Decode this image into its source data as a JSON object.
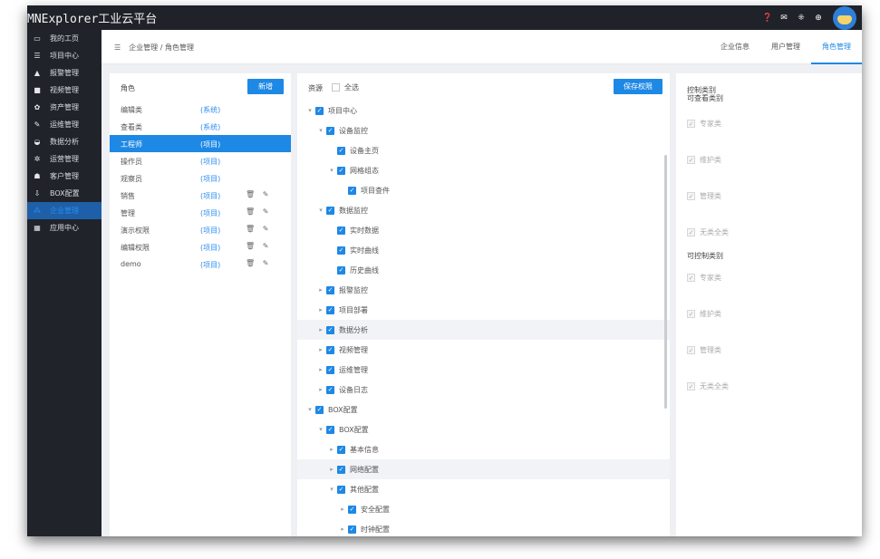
{
  "app": {
    "title": "MNExplorer工业云平台"
  },
  "topbar": {
    "icons": [
      "help-icon",
      "mail-icon",
      "apps-icon",
      "globe-icon"
    ],
    "icon_glyphs": [
      "❓",
      "✉",
      "⁜",
      "⊕"
    ]
  },
  "sidebar": {
    "items": [
      {
        "label": "我的工页",
        "icon": "monitor-icon",
        "glyph": "▭"
      },
      {
        "label": "项目中心",
        "icon": "list-icon",
        "glyph": "☰"
      },
      {
        "label": "报警管理",
        "icon": "bell-icon",
        "glyph": "▲"
      },
      {
        "label": "视频管理",
        "icon": "camera-icon",
        "glyph": "■"
      },
      {
        "label": "资产管理",
        "icon": "gear-icon",
        "glyph": "✿"
      },
      {
        "label": "运维管理",
        "icon": "wrench-icon",
        "glyph": "✎"
      },
      {
        "label": "数据分析",
        "icon": "dashboard-icon",
        "glyph": "◒"
      },
      {
        "label": "运营管理",
        "icon": "cogs-icon",
        "glyph": "✲"
      },
      {
        "label": "客户管理",
        "icon": "users-icon",
        "glyph": "☗"
      },
      {
        "label": "BOX配置",
        "icon": "download-icon",
        "glyph": "⇩"
      },
      {
        "label": "企业管理",
        "icon": "org-icon",
        "glyph": "⁂"
      },
      {
        "label": "应用中心",
        "icon": "grid-icon",
        "glyph": "▦"
      }
    ]
  },
  "header": {
    "breadcrumb": "企业管理 / 角色管理",
    "menu_glyph": "☰",
    "tabs": [
      {
        "label": "企业信息"
      },
      {
        "label": "用户管理"
      },
      {
        "label": "角色管理"
      }
    ]
  },
  "roles": {
    "label": "角色",
    "add_button": "新增",
    "rows": [
      {
        "name": "编辑类",
        "type": "(系统)",
        "actions": ""
      },
      {
        "name": "查看类",
        "type": "(系统)",
        "actions": ""
      },
      {
        "name": "工程师",
        "type": "(项目)",
        "actions": ""
      },
      {
        "name": "操作员",
        "type": "(项目)",
        "actions": ""
      },
      {
        "name": "观察员",
        "type": "(项目)",
        "actions": ""
      },
      {
        "name": "销售",
        "type": "(项目)",
        "actions": "🗑 ✎"
      },
      {
        "name": "管理",
        "type": "(项目)",
        "actions": "🗑 ✎"
      },
      {
        "name": "演示权限",
        "type": "(项目)",
        "actions": "🗑 ✎"
      },
      {
        "name": "编辑权限",
        "type": "(项目)",
        "actions": "🗑 ✎"
      },
      {
        "name": "demo",
        "type": "(项目)",
        "actions": "🗑 ✎"
      }
    ]
  },
  "resources": {
    "label": "资源",
    "select_all": "全选",
    "save_button": "保存权限",
    "tree": [
      {
        "label": "项目中心",
        "level": 0,
        "arrow": "▾"
      },
      {
        "label": "设备监控",
        "level": 1,
        "arrow": "▾"
      },
      {
        "label": "设备主页",
        "level": 2,
        "arrow": ""
      },
      {
        "label": "网格组态",
        "level": 2,
        "arrow": "▾"
      },
      {
        "label": "项目查件",
        "level": 3,
        "arrow": ""
      },
      {
        "label": "数据监控",
        "level": 1,
        "arrow": "▾"
      },
      {
        "label": "实时数据",
        "level": 2,
        "arrow": ""
      },
      {
        "label": "实时曲线",
        "level": 2,
        "arrow": ""
      },
      {
        "label": "历史曲线",
        "level": 2,
        "arrow": ""
      },
      {
        "label": "报警监控",
        "level": 1,
        "arrow": "▸"
      },
      {
        "label": "项目部署",
        "level": 1,
        "arrow": "▸"
      },
      {
        "label": "数据分析",
        "level": 1,
        "arrow": "▸"
      },
      {
        "label": "视频管理",
        "level": 1,
        "arrow": "▸"
      },
      {
        "label": "运维管理",
        "level": 1,
        "arrow": "▸"
      },
      {
        "label": "设备日志",
        "level": 1,
        "arrow": "▸"
      },
      {
        "label": "BOX配置",
        "level": 0,
        "arrow": "▾"
      },
      {
        "label": "BOX配置",
        "level": 1,
        "arrow": "▾"
      },
      {
        "label": "基本信息",
        "level": 2,
        "arrow": "▸"
      },
      {
        "label": "网络配置",
        "level": 2,
        "arrow": "▸"
      },
      {
        "label": "其他配置",
        "level": 2,
        "arrow": "▾"
      },
      {
        "label": "安全配置",
        "level": 3,
        "arrow": "▸"
      },
      {
        "label": "时钟配置",
        "level": 3,
        "arrow": "▸"
      }
    ]
  },
  "categories": {
    "title": "控制类别",
    "viewable_title": "可查看类别",
    "viewable": [
      "专家类",
      "维护类",
      "管理类",
      "无类全类"
    ],
    "controllable_title": "可控制类别",
    "controllable": [
      "专家类",
      "维护类",
      "管理类",
      "无类全类"
    ]
  }
}
